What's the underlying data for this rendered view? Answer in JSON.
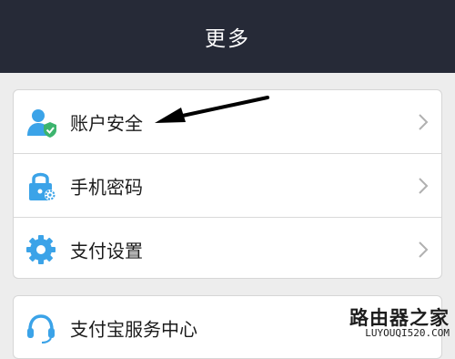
{
  "header": {
    "title": "更多"
  },
  "menu": {
    "group1": [
      {
        "label": "账户安全",
        "icon": "account-security-icon"
      },
      {
        "label": "手机密码",
        "icon": "phone-lock-icon"
      },
      {
        "label": "支付设置",
        "icon": "gear-icon"
      }
    ],
    "group2": [
      {
        "label": "支付宝服务中心",
        "icon": "headset-icon"
      }
    ]
  },
  "watermark": {
    "text": "路由器之家",
    "url": "LUYOUQI520.COM"
  },
  "colors": {
    "header_bg": "#262a37",
    "page_bg": "#ededed",
    "icon_blue": "#3ba3e8",
    "shield_green": "#3cb46e"
  }
}
